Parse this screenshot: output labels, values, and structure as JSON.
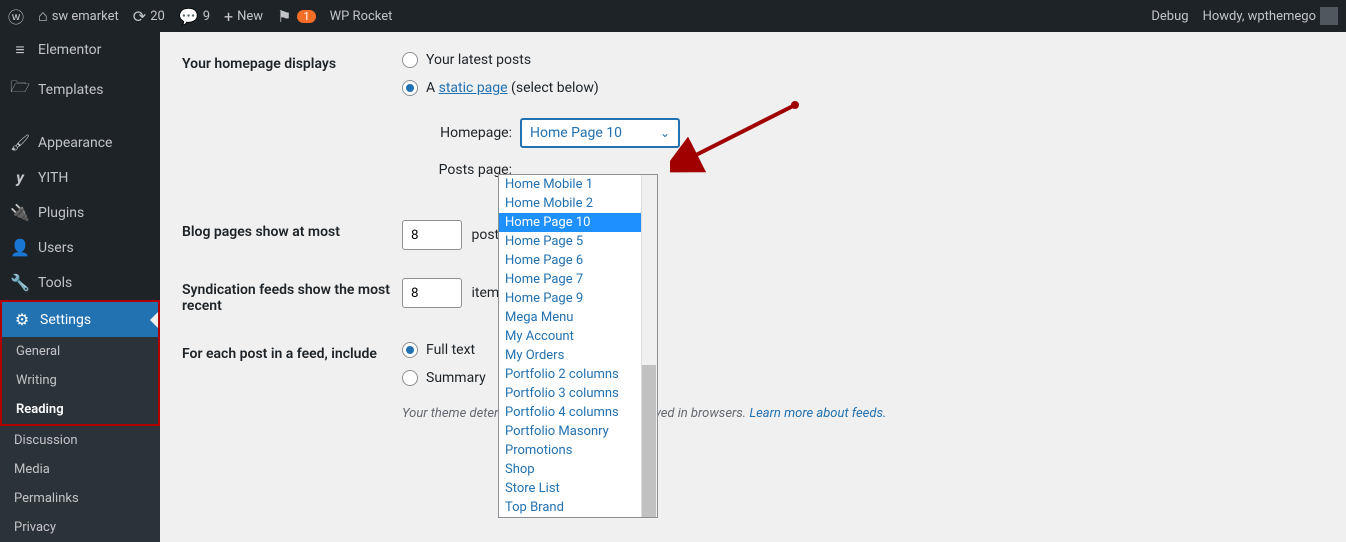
{
  "adminBar": {
    "siteName": "sw emarket",
    "updates": "20",
    "comments": "9",
    "new": "New",
    "notif": "1",
    "wprocket": "WP Rocket",
    "debug": "Debug",
    "howdy": "Howdy, wpthemego"
  },
  "sidebar": {
    "elementor": "Elementor",
    "templates": "Templates",
    "appearance": "Appearance",
    "yith": "YITH",
    "plugins": "Plugins",
    "users": "Users",
    "tools": "Tools",
    "settings": "Settings",
    "submenu": {
      "general": "General",
      "writing": "Writing",
      "reading": "Reading",
      "discussion": "Discussion",
      "media": "Media",
      "permalinks": "Permalinks",
      "privacy": "Privacy"
    }
  },
  "form": {
    "homepageLabel": "Your homepage displays",
    "latestPosts": "Your latest posts",
    "staticPrefix": "A ",
    "staticLink": "static page",
    "staticSuffix": " (select below)",
    "homepageSelLabel": "Homepage:",
    "postsSelLabel": "Posts page:",
    "selectedHomepage": "Home Page 10",
    "blogPagesLabel": "Blog pages show at most",
    "blogPagesValue": "8",
    "postsUnit": "posts",
    "syndLabel": "Syndication feeds show the most recent",
    "syndValue": "8",
    "itemsUnit": "items",
    "feedLabel": "For each post in a feed, include",
    "fullText": "Full text",
    "summary": "Summary",
    "notePrefix": "Your theme determines how content is displayed in browsers. ",
    "noteLink": "Learn more about feeds."
  },
  "dropdown": {
    "items": [
      "Home Mobile 1",
      "Home Mobile 2",
      "Home Page 10",
      "Home Page 5",
      "Home Page 6",
      "Home Page 7",
      "Home Page 9",
      "Mega Menu",
      "My Account",
      "My Orders",
      "Portfolio 2 columns",
      "Portfolio 3 columns",
      "Portfolio 4 columns",
      "Portfolio Masonry",
      "Promotions",
      "Shop",
      "Store List",
      "Top Brand"
    ],
    "selectedIndex": 2
  },
  "colors": {
    "accent": "#2271b1",
    "arrow": "#a00000"
  }
}
